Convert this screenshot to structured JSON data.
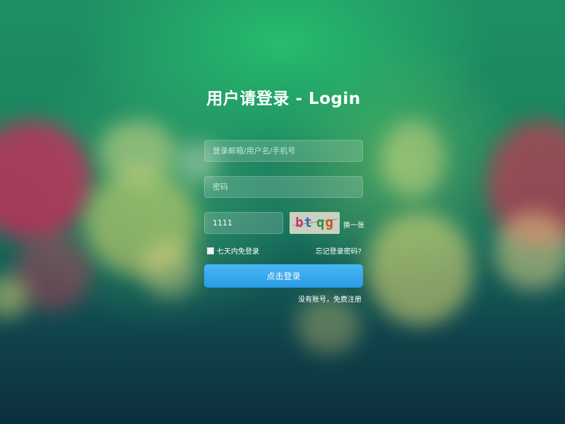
{
  "login": {
    "title": "用户请登录 - Login",
    "username_placeholder": "登录邮箱/用户名/手机号",
    "password_placeholder": "密码",
    "captcha_value": "1111",
    "captcha_image_text": "btqg",
    "refresh_label": "换一张",
    "remember_label": "七天内免登录",
    "forgot_label": "忘记登录密码?",
    "submit_label": "点击登录",
    "register_label": "没有账号，免费注册"
  },
  "colors": {
    "button": "#2a9be8",
    "background_top": "#1f8f63",
    "background_bottom": "#0c2f3d"
  }
}
